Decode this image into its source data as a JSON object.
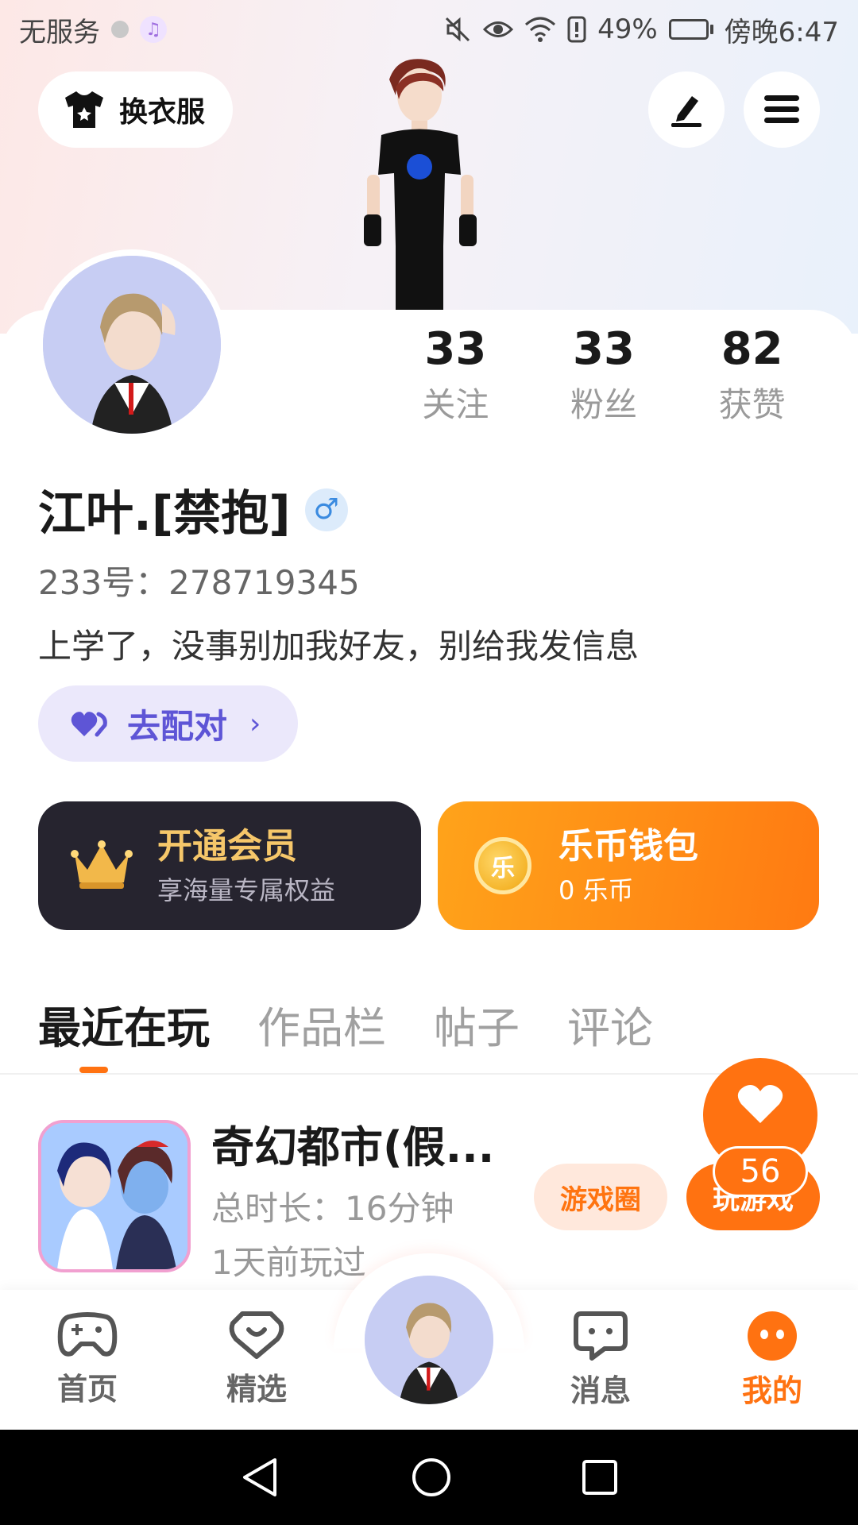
{
  "status_bar": {
    "carrier": "无服务",
    "battery_percent": "49%",
    "battery_level": 0.49,
    "time": "傍晚6:47"
  },
  "header": {
    "wardrobe_label": "换衣服",
    "edit_icon": "pencil-icon",
    "menu_icon": "hamburger-menu-icon"
  },
  "profile": {
    "stats": [
      {
        "value": "33",
        "label": "关注"
      },
      {
        "value": "33",
        "label": "粉丝"
      },
      {
        "value": "82",
        "label": "获赞"
      }
    ],
    "nickname": "江叶.[禁抱]",
    "gender_symbol": "♂",
    "user_id": "233号：278719345",
    "bio": "上学了，没事别加我好友，别给我发信息",
    "match_label": "去配对"
  },
  "vip": {
    "title": "开通会员",
    "subtitle": "享海量专属权益"
  },
  "wallet": {
    "coin_symbol": "乐",
    "title": "乐币钱包",
    "subtitle": "0 乐币"
  },
  "tabs": [
    {
      "label": "最近在玩",
      "active": true
    },
    {
      "label": "作品栏",
      "active": false
    },
    {
      "label": "帖子",
      "active": false
    },
    {
      "label": "评论",
      "active": false
    }
  ],
  "recent_games": [
    {
      "name": "奇幻都市(假...",
      "duration": "总时长：16分钟",
      "last_played": "1天前玩过",
      "circle_label": "游戏圈",
      "play_label": "玩游戏"
    }
  ],
  "like_float": {
    "count": "56"
  },
  "bottom_nav": [
    {
      "label": "首页",
      "icon": "gamepad-icon",
      "active": false
    },
    {
      "label": "精选",
      "icon": "heart-chat-icon",
      "active": false
    },
    {
      "label": "消息",
      "icon": "chat-bubble-icon",
      "active": false
    },
    {
      "label": "我的",
      "icon": "profile-face-icon",
      "active": true
    }
  ],
  "colors": {
    "accent": "#ff7211",
    "match_purple": "#5e55d6",
    "vip_dark": "#26242f",
    "vip_gold": "#f6c76a"
  }
}
